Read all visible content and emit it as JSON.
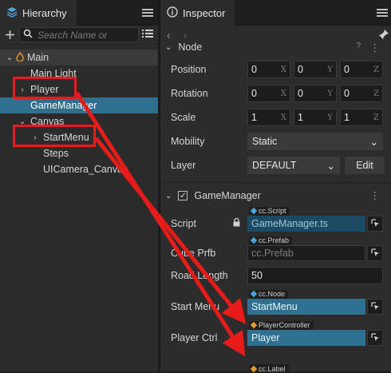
{
  "hierarchy": {
    "tab_label": "Hierarchy",
    "search_placeholder": "Search Name or",
    "nodes": [
      {
        "label": "Main",
        "indent": 0,
        "expanded": true,
        "root": true
      },
      {
        "label": "Main Light",
        "indent": 1
      },
      {
        "label": "Player",
        "indent": 1,
        "collapsed": true
      },
      {
        "label": "GameManager",
        "indent": 1,
        "selected": true
      },
      {
        "label": "Canvas",
        "indent": 1,
        "expanded": true
      },
      {
        "label": "StartMenu",
        "indent": 2,
        "collapsed": true
      },
      {
        "label": "Steps",
        "indent": 2
      },
      {
        "label": "UICamera_Canvas",
        "indent": 2
      }
    ]
  },
  "inspector": {
    "tab_label": "Inspector",
    "node_section": "Node",
    "position": {
      "label": "Position",
      "x": "0",
      "y": "0",
      "z": "0"
    },
    "rotation": {
      "label": "Rotation",
      "x": "0",
      "y": "0",
      "z": "0"
    },
    "scale": {
      "label": "Scale",
      "x": "1",
      "y": "1",
      "z": "1"
    },
    "axis_labels": {
      "x": "X",
      "y": "Y",
      "z": "Z"
    },
    "mobility": {
      "label": "Mobility",
      "value": "Static"
    },
    "layer": {
      "label": "Layer",
      "value": "DEFAULT",
      "edit_label": "Edit"
    },
    "component": {
      "name": "GameManager",
      "script": {
        "label": "Script",
        "tag": "cc.Script",
        "value": "GameManager.ts"
      },
      "cube_prfb": {
        "label": "Cube Prfb",
        "tag": "cc.Prefab",
        "value": "cc.Prefab"
      },
      "road_length": {
        "label": "Road Length",
        "value": "50"
      },
      "start_menu": {
        "label": "Start Menu",
        "tag": "cc.Node",
        "value": "StartMenu"
      },
      "player_ctrl": {
        "label": "Player Ctrl",
        "tag": "PlayerController",
        "value": "Player"
      },
      "next_tag": "cc.Label"
    }
  },
  "colors": {
    "selection": "#2f6f8f",
    "annotation_red": "#e81b1b",
    "accent_blue": "#4aa3d8"
  }
}
